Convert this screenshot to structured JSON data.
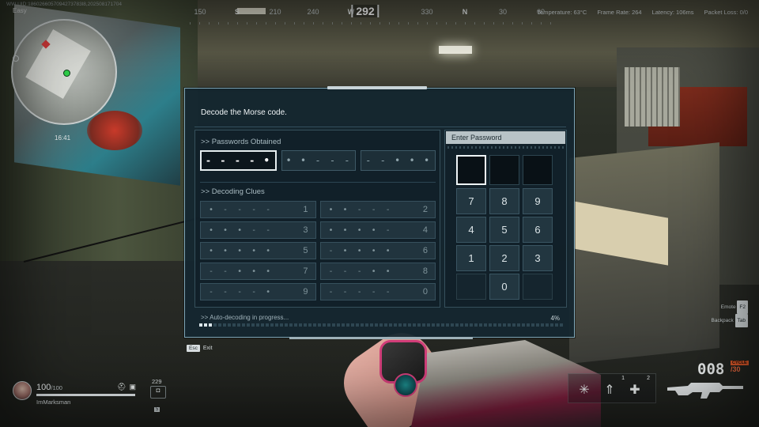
{
  "hud": {
    "uid": "WW UID:1860266057094273783l8,202508171704",
    "difficulty": "Easy",
    "stats": {
      "temperature": "Temperature: 63°C",
      "frame_rate": "Frame Rate: 264",
      "latency": "Latency: 106ms",
      "packet_loss": "Packet Loss: 0/0"
    },
    "compass": {
      "heading": "292",
      "marks": [
        {
          "label": "150",
          "kind": "num"
        },
        {
          "label": "S",
          "kind": "dir"
        },
        {
          "label": "210",
          "kind": "num"
        },
        {
          "label": "240",
          "kind": "num"
        },
        {
          "label": "W",
          "kind": "dir"
        },
        {
          "label": "330",
          "kind": "num"
        },
        {
          "label": "N",
          "kind": "dir"
        },
        {
          "label": "30",
          "kind": "num"
        },
        {
          "label": "60",
          "kind": "num"
        }
      ]
    },
    "map_time": "16:41"
  },
  "panel": {
    "title": "Decode the Morse code.",
    "passwords_label": ">> Passwords Obtained",
    "passwords": [
      {
        "code": "- - - - •",
        "active": true
      },
      {
        "code": "• • - - -",
        "active": false
      },
      {
        "code": "- - • • •",
        "active": false
      }
    ],
    "clues_label": ">> Decoding Clues",
    "clues": [
      {
        "code": "• - - - -",
        "digit": "1"
      },
      {
        "code": "• • - - -",
        "digit": "2"
      },
      {
        "code": "• • • - -",
        "digit": "3"
      },
      {
        "code": "• • • • -",
        "digit": "4"
      },
      {
        "code": "• • • • •",
        "digit": "5"
      },
      {
        "code": "- • • • •",
        "digit": "6"
      },
      {
        "code": "- - • • •",
        "digit": "7"
      },
      {
        "code": "- - - • •",
        "digit": "8"
      },
      {
        "code": "- - - - •",
        "digit": "9"
      },
      {
        "code": "- - - - -",
        "digit": "0"
      }
    ],
    "entry_header": "Enter Password",
    "entry_slots": [
      "",
      "",
      ""
    ],
    "keypad": [
      {
        "label": "7"
      },
      {
        "label": "8"
      },
      {
        "label": "9"
      },
      {
        "label": "4"
      },
      {
        "label": "5"
      },
      {
        "label": "6"
      },
      {
        "label": "1"
      },
      {
        "label": "2"
      },
      {
        "label": "3"
      },
      {
        "label": ""
      },
      {
        "label": "0"
      },
      {
        "label": ""
      }
    ],
    "progress_label": ">> Auto-decoding in progress...",
    "progress_pct_text": "4%",
    "progress_value": 0.04
  },
  "exit": {
    "key": "Esc",
    "label": "Exit"
  },
  "player": {
    "hp": "100",
    "hp_max": "/100",
    "name": "ImMarksman",
    "ammo_small": "229"
  },
  "right_hints": {
    "emote": "Emote",
    "emote_key": "F2",
    "backpack": "Backpack",
    "backpack_key": "Tab"
  },
  "weapon": {
    "ammo": "008",
    "reserve": "/30",
    "fire_mode": "CYCLE"
  },
  "tactical_counts": {
    "first": "1",
    "second": "2"
  }
}
